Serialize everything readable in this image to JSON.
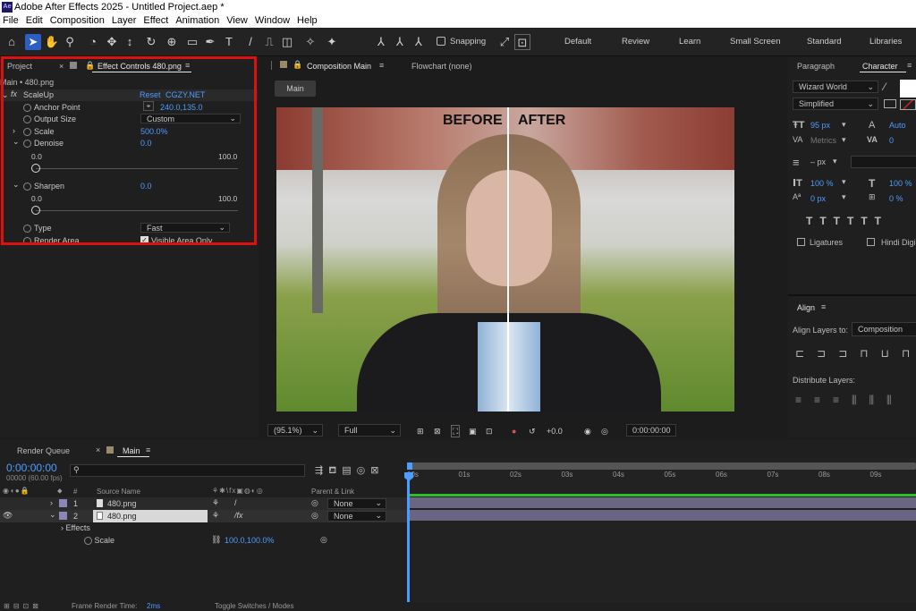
{
  "window": {
    "title": "Adobe After Effects 2025 - Untitled Project.aep *",
    "logo": "Ae"
  },
  "menu": [
    "File",
    "Edit",
    "Composition",
    "Layer",
    "Effect",
    "Animation",
    "View",
    "Window",
    "Help"
  ],
  "toolbar": {
    "snapping": "Snapping",
    "workspaces": [
      "Default",
      "Review",
      "Learn",
      "Small Screen",
      "Standard",
      "Libraries"
    ]
  },
  "left_panel": {
    "tab_project": "Project",
    "tab_effect": "Effect Controls 480.png",
    "subtitle": "Main • 480.png",
    "effect_name": "ScaleUp",
    "reset": "Reset",
    "brand": "CGZY.NET",
    "anchor_label": "Anchor Point",
    "anchor_value": "240.0,135.0",
    "output_label": "Output Size",
    "output_value": "Custom",
    "scale_label": "Scale",
    "scale_value": "500.0%",
    "denoise_label": "Denoise",
    "denoise_value": "0.0",
    "denoise_min": "0.0",
    "denoise_max": "100.0",
    "sharpen_label": "Sharpen",
    "sharpen_value": "0.0",
    "sharpen_min": "0.0",
    "sharpen_max": "100.0",
    "type_label": "Type",
    "type_value": "Fast",
    "render_label": "Render Area",
    "render_value": "Visible Area Only"
  },
  "comp_panel": {
    "tab": "Composition Main",
    "flowchart": "Flowchart (none)",
    "main_btn": "Main",
    "before": "BEFORE",
    "after": "AFTER",
    "zoom": "(95.1%)",
    "resolution": "Full",
    "exposure": "+0.0",
    "timecode": "0:00:00:00"
  },
  "right_panel": {
    "tab_paragraph": "Paragraph",
    "tab_character": "Character",
    "font": "Wizard World",
    "style": "Simplified",
    "font_size": "95 px",
    "leading": "Auto",
    "kerning": "Metrics",
    "tracking": "0",
    "stroke": "– px",
    "vscale": "100 %",
    "hscale": "100 %",
    "baseline": "0 px",
    "tsume": "0 %",
    "ligatures": "Ligatures",
    "hindi": "Hindi Digi",
    "align_tab": "Align",
    "align_to_label": "Align Layers to:",
    "align_to": "Composition",
    "distribute": "Distribute Layers:"
  },
  "timeline": {
    "tab_render": "Render Queue",
    "tab_main": "Main",
    "time": "0:00:00:00",
    "fps": "00000 (60.00 fps)",
    "source_name": "Source Name",
    "parent_link": "Parent & Link",
    "layers": [
      {
        "num": "1",
        "name": "480.png",
        "parent": "None"
      },
      {
        "num": "2",
        "name": "480.png",
        "parent": "None"
      }
    ],
    "effects": "Effects",
    "scale_prop": "Scale",
    "scale_val": "100.0,100.0%",
    "ticks": [
      "00s",
      "01s",
      "02s",
      "03s",
      "04s",
      "05s",
      "06s",
      "07s",
      "08s",
      "09s"
    ],
    "frame_render": "Frame Render Time:",
    "frame_time": "2ms",
    "toggle": "Toggle Switches / Modes"
  }
}
